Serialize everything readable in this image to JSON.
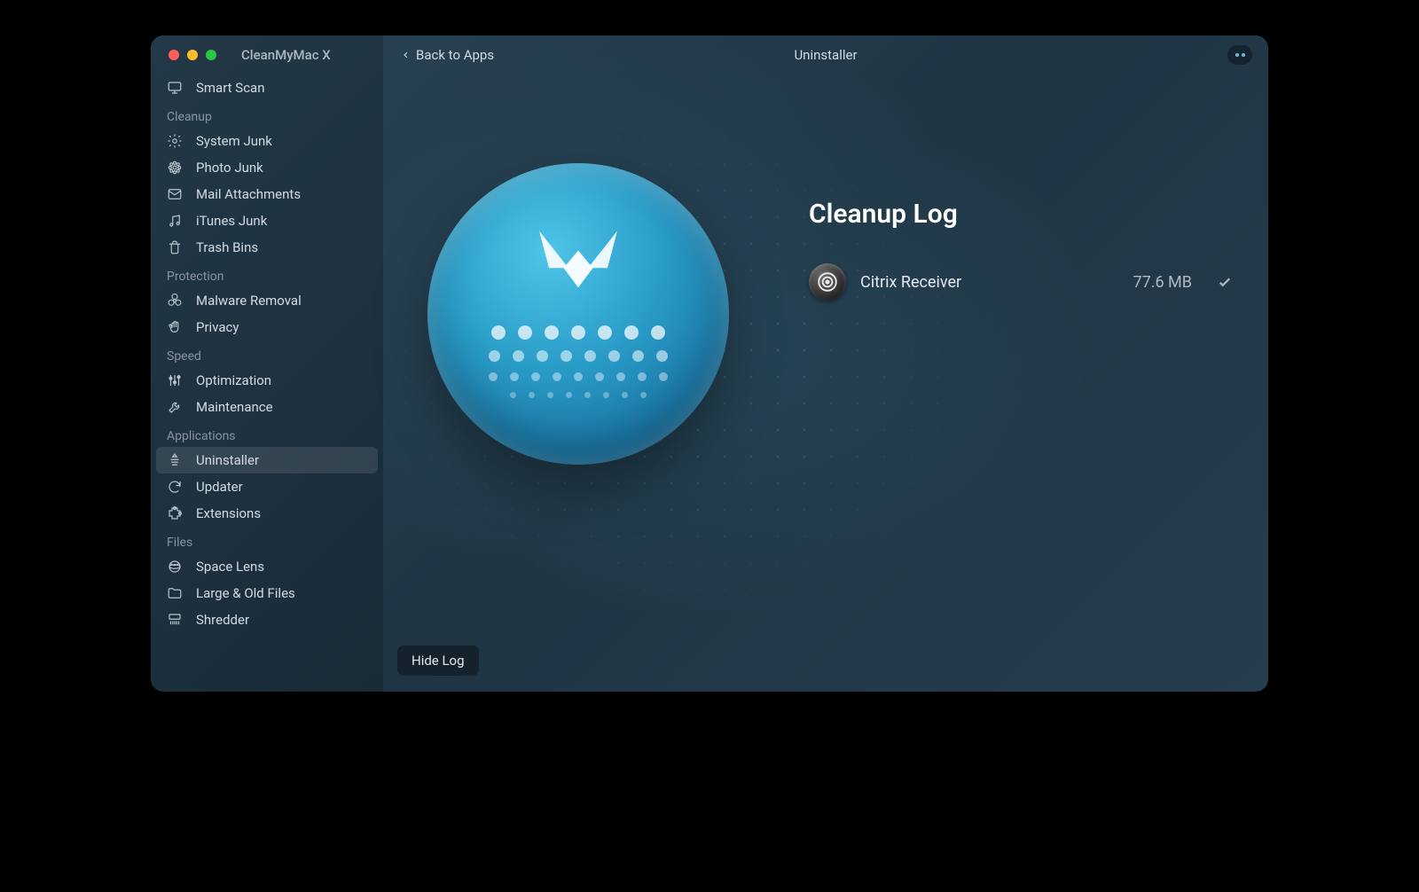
{
  "app_title": "CleanMyMac X",
  "header": {
    "back_label": "Back to Apps",
    "page_title": "Uninstaller"
  },
  "sidebar": {
    "smart_scan": "Smart Scan",
    "sections": [
      {
        "label": "Cleanup",
        "items": [
          {
            "icon": "gear-icon",
            "label": "System Junk"
          },
          {
            "icon": "flower-icon",
            "label": "Photo Junk"
          },
          {
            "icon": "mail-icon",
            "label": "Mail Attachments"
          },
          {
            "icon": "music-icon",
            "label": "iTunes Junk"
          },
          {
            "icon": "trash-icon",
            "label": "Trash Bins"
          }
        ]
      },
      {
        "label": "Protection",
        "items": [
          {
            "icon": "biohazard-icon",
            "label": "Malware Removal"
          },
          {
            "icon": "hand-icon",
            "label": "Privacy"
          }
        ]
      },
      {
        "label": "Speed",
        "items": [
          {
            "icon": "sliders-icon",
            "label": "Optimization"
          },
          {
            "icon": "wrench-icon",
            "label": "Maintenance"
          }
        ]
      },
      {
        "label": "Applications",
        "items": [
          {
            "icon": "uninstall-icon",
            "label": "Uninstaller",
            "active": true
          },
          {
            "icon": "refresh-icon",
            "label": "Updater"
          },
          {
            "icon": "puzzle-icon",
            "label": "Extensions"
          }
        ]
      },
      {
        "label": "Files",
        "items": [
          {
            "icon": "lens-icon",
            "label": "Space Lens"
          },
          {
            "icon": "folder-icon",
            "label": "Large & Old Files"
          },
          {
            "icon": "shredder-icon",
            "label": "Shredder"
          }
        ]
      }
    ]
  },
  "main": {
    "log_title": "Cleanup Log",
    "hide_log": "Hide Log",
    "items": [
      {
        "name": "Citrix Receiver",
        "size": "77.6 MB"
      }
    ]
  }
}
